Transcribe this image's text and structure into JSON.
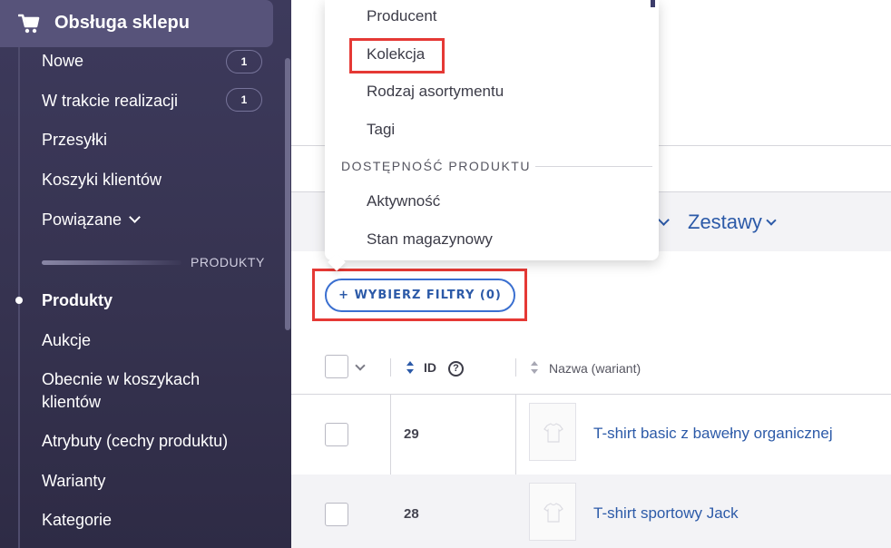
{
  "sidebar": {
    "header_title": "Obsługa sklepu",
    "items": [
      {
        "label": "Nowe",
        "badge": "1"
      },
      {
        "label": "W trakcie realizacji",
        "badge": "1"
      },
      {
        "label": "Przesyłki"
      },
      {
        "label": "Koszyki klientów"
      },
      {
        "label": "Powiązane"
      }
    ],
    "section_label": "PRODUKTY",
    "product_items": [
      {
        "label": "Produkty",
        "active": true
      },
      {
        "label": "Aukcje"
      },
      {
        "label": "Obecnie w koszykach klientów"
      },
      {
        "label": "Atrybuty (cechy produktu)"
      },
      {
        "label": "Warianty"
      },
      {
        "label": "Kategorie"
      }
    ]
  },
  "dropdown": {
    "items_top": [
      "Producent",
      "Kolekcja",
      "Rodzaj asortymentu",
      "Tagi"
    ],
    "section": "DOSTĘPNOŚĆ PRODUKTU",
    "items_bottom": [
      "Aktywność",
      "Stan magazynowy"
    ],
    "highlighted": "Kolekcja"
  },
  "tabs": {
    "sets_label": "Zestawy"
  },
  "filter_button": "+ WYBIERZ FILTRY (0)",
  "table": {
    "headers": {
      "id": "ID",
      "help": "?",
      "name": "Nazwa (wariant)"
    },
    "rows": [
      {
        "id": "29",
        "name": "T-shirt basic z bawełny organicznej"
      },
      {
        "id": "28",
        "name": "T-shirt sportowy Jack"
      }
    ]
  },
  "colors": {
    "sidebar_bg": "#3d3a5c",
    "accent": "#2c5aa8",
    "highlight": "#e53935"
  }
}
